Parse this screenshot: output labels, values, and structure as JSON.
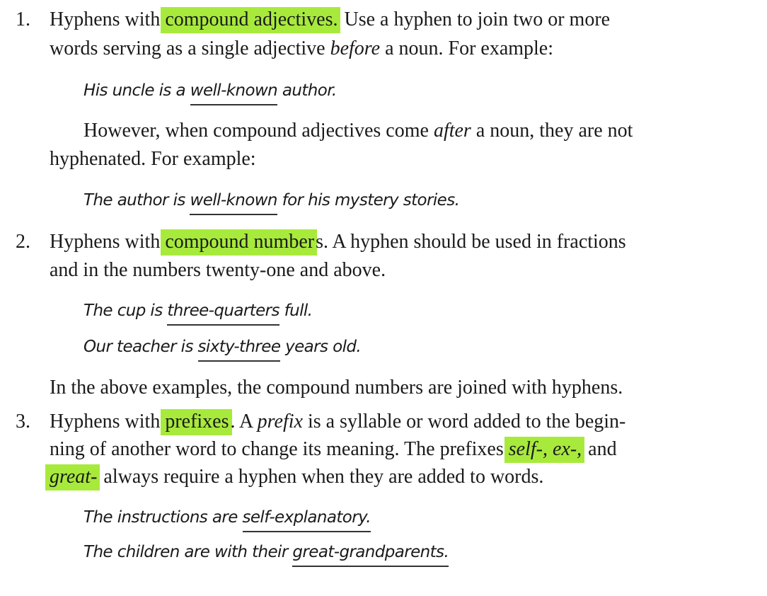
{
  "item1": {
    "number": "1.",
    "line1_pre": "Hyphens with ",
    "line1_hl": "compound adjectives.",
    "line1_post": " Use a hyphen to join two or more",
    "line2_pre": "words serving as a single adjective ",
    "line2_em": "before",
    "line2_post": " a noun. For example:",
    "example1_pre": "His uncle is a ",
    "example1_ul": "well-known",
    "example1_post": " author.",
    "para_pre": "However, when compound adjectives come ",
    "para_em": "after",
    "para_post": " a noun, they are not",
    "para_line2": "hyphenated. For example:",
    "example2_pre": "The author is ",
    "example2_ul": "well-known",
    "example2_post": " for his mystery stories."
  },
  "item2": {
    "number": "2.",
    "line1_pre": "Hyphens with ",
    "line1_hl": "compound number",
    "line1_post": "s. A hyphen should be used in fractions",
    "line2": "and in the numbers twenty-one and above.",
    "example1_pre": "The cup is ",
    "example1_ul": "three-quarters",
    "example1_post": " full.",
    "example2_pre": "Our teacher is ",
    "example2_ul": "sixty-three",
    "example2_post": " years old.",
    "para": "In the above examples, the compound numbers are joined with hyphens."
  },
  "item3": {
    "number": "3.",
    "line1_pre": "Hyphens with ",
    "line1_hl": "prefixes",
    "line1_mid": ". A ",
    "line1_em": "prefix",
    "line1_post": " is a syllable or word added to the begin-",
    "line2_pre": "ning of another word to change its meaning. The prefixes ",
    "line2_hl": "self-, ex-,",
    "line2_post": " and",
    "line3_hl": "great-",
    "line3_post": " always require a hyphen when they are added to words.",
    "example1_pre": "The instructions are ",
    "example1_ul": "self-explanatory.",
    "example2_pre": "The children are with their ",
    "example2_ul": "great-grandparents."
  }
}
